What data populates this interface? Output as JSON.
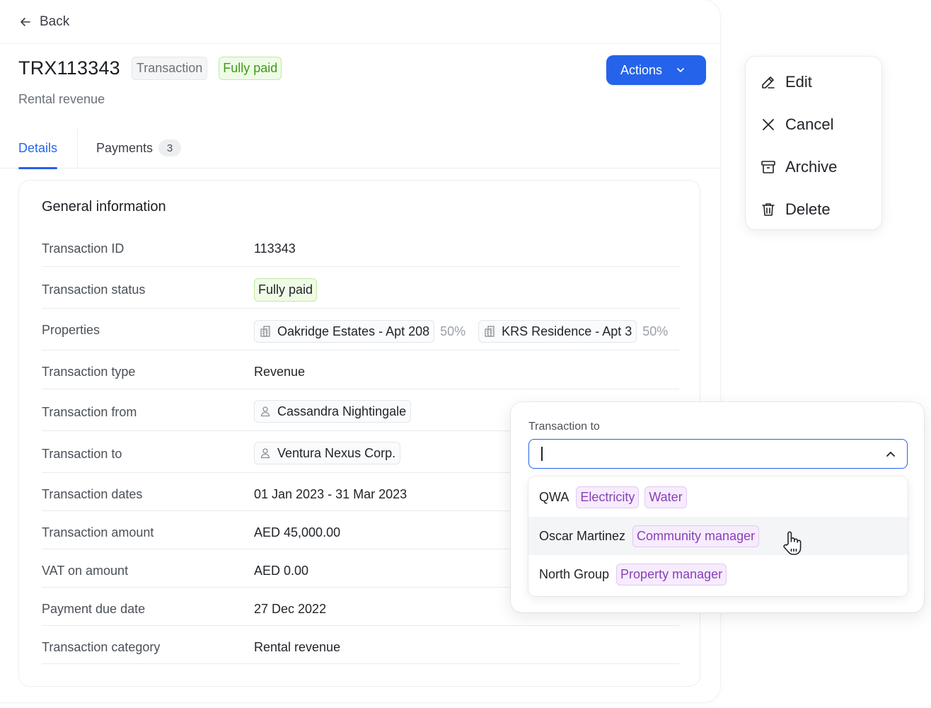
{
  "header": {
    "back_label": "Back",
    "title": "TRX113343",
    "type_tag": "Transaction",
    "status_tag": "Fully paid",
    "subtitle": "Rental revenue",
    "actions_label": "Actions"
  },
  "tabs": [
    {
      "label": "Details"
    },
    {
      "label": "Payments",
      "count": "3"
    }
  ],
  "card": {
    "title": "General information",
    "rows": {
      "transaction_id": {
        "label": "Transaction ID",
        "value": "113343"
      },
      "status": {
        "label": "Transaction status",
        "value": "Fully paid"
      },
      "properties": {
        "label": "Properties",
        "items": [
          {
            "name": "Oakridge Estates - Apt 208",
            "share": "50%"
          },
          {
            "name": "KRS Residence - Apt 3",
            "share": "50%"
          }
        ]
      },
      "type": {
        "label": "Transaction type",
        "value": "Revenue"
      },
      "from": {
        "label": "Transaction from",
        "value": "Cassandra Nightingale"
      },
      "to": {
        "label": "Transaction to",
        "value": "Ventura Nexus Corp."
      },
      "dates": {
        "label": "Transaction dates",
        "value": "01 Jan 2023 - 31 Mar 2023"
      },
      "amount": {
        "label": "Transaction amount",
        "value": "AED 45,000.00"
      },
      "vat": {
        "label": "VAT on amount",
        "value": "AED 0.00"
      },
      "due": {
        "label": "Payment due date",
        "value": "27 Dec 2022"
      },
      "category": {
        "label": "Transaction category",
        "value": "Rental revenue"
      }
    }
  },
  "actions_menu": {
    "items": [
      {
        "label": "Edit",
        "icon": "pencil-icon"
      },
      {
        "label": "Cancel",
        "icon": "close-icon"
      },
      {
        "label": "Archive",
        "icon": "archive-icon"
      },
      {
        "label": "Delete",
        "icon": "trash-icon"
      }
    ]
  },
  "select": {
    "label": "Transaction to",
    "value": "",
    "options": [
      {
        "name": "QWA",
        "tags": [
          "Electricity",
          "Water"
        ]
      },
      {
        "name": "Oscar Martinez",
        "tags": [
          "Community manager"
        ],
        "hovered": true
      },
      {
        "name": "North Group",
        "tags": [
          "Property manager"
        ]
      }
    ]
  },
  "colors": {
    "primary": "#2563eb",
    "success_text": "#3f9a1a",
    "success_bg": "#effbe6",
    "purple_text": "#8a3fb8",
    "purple_bg": "#f6ecfd"
  }
}
